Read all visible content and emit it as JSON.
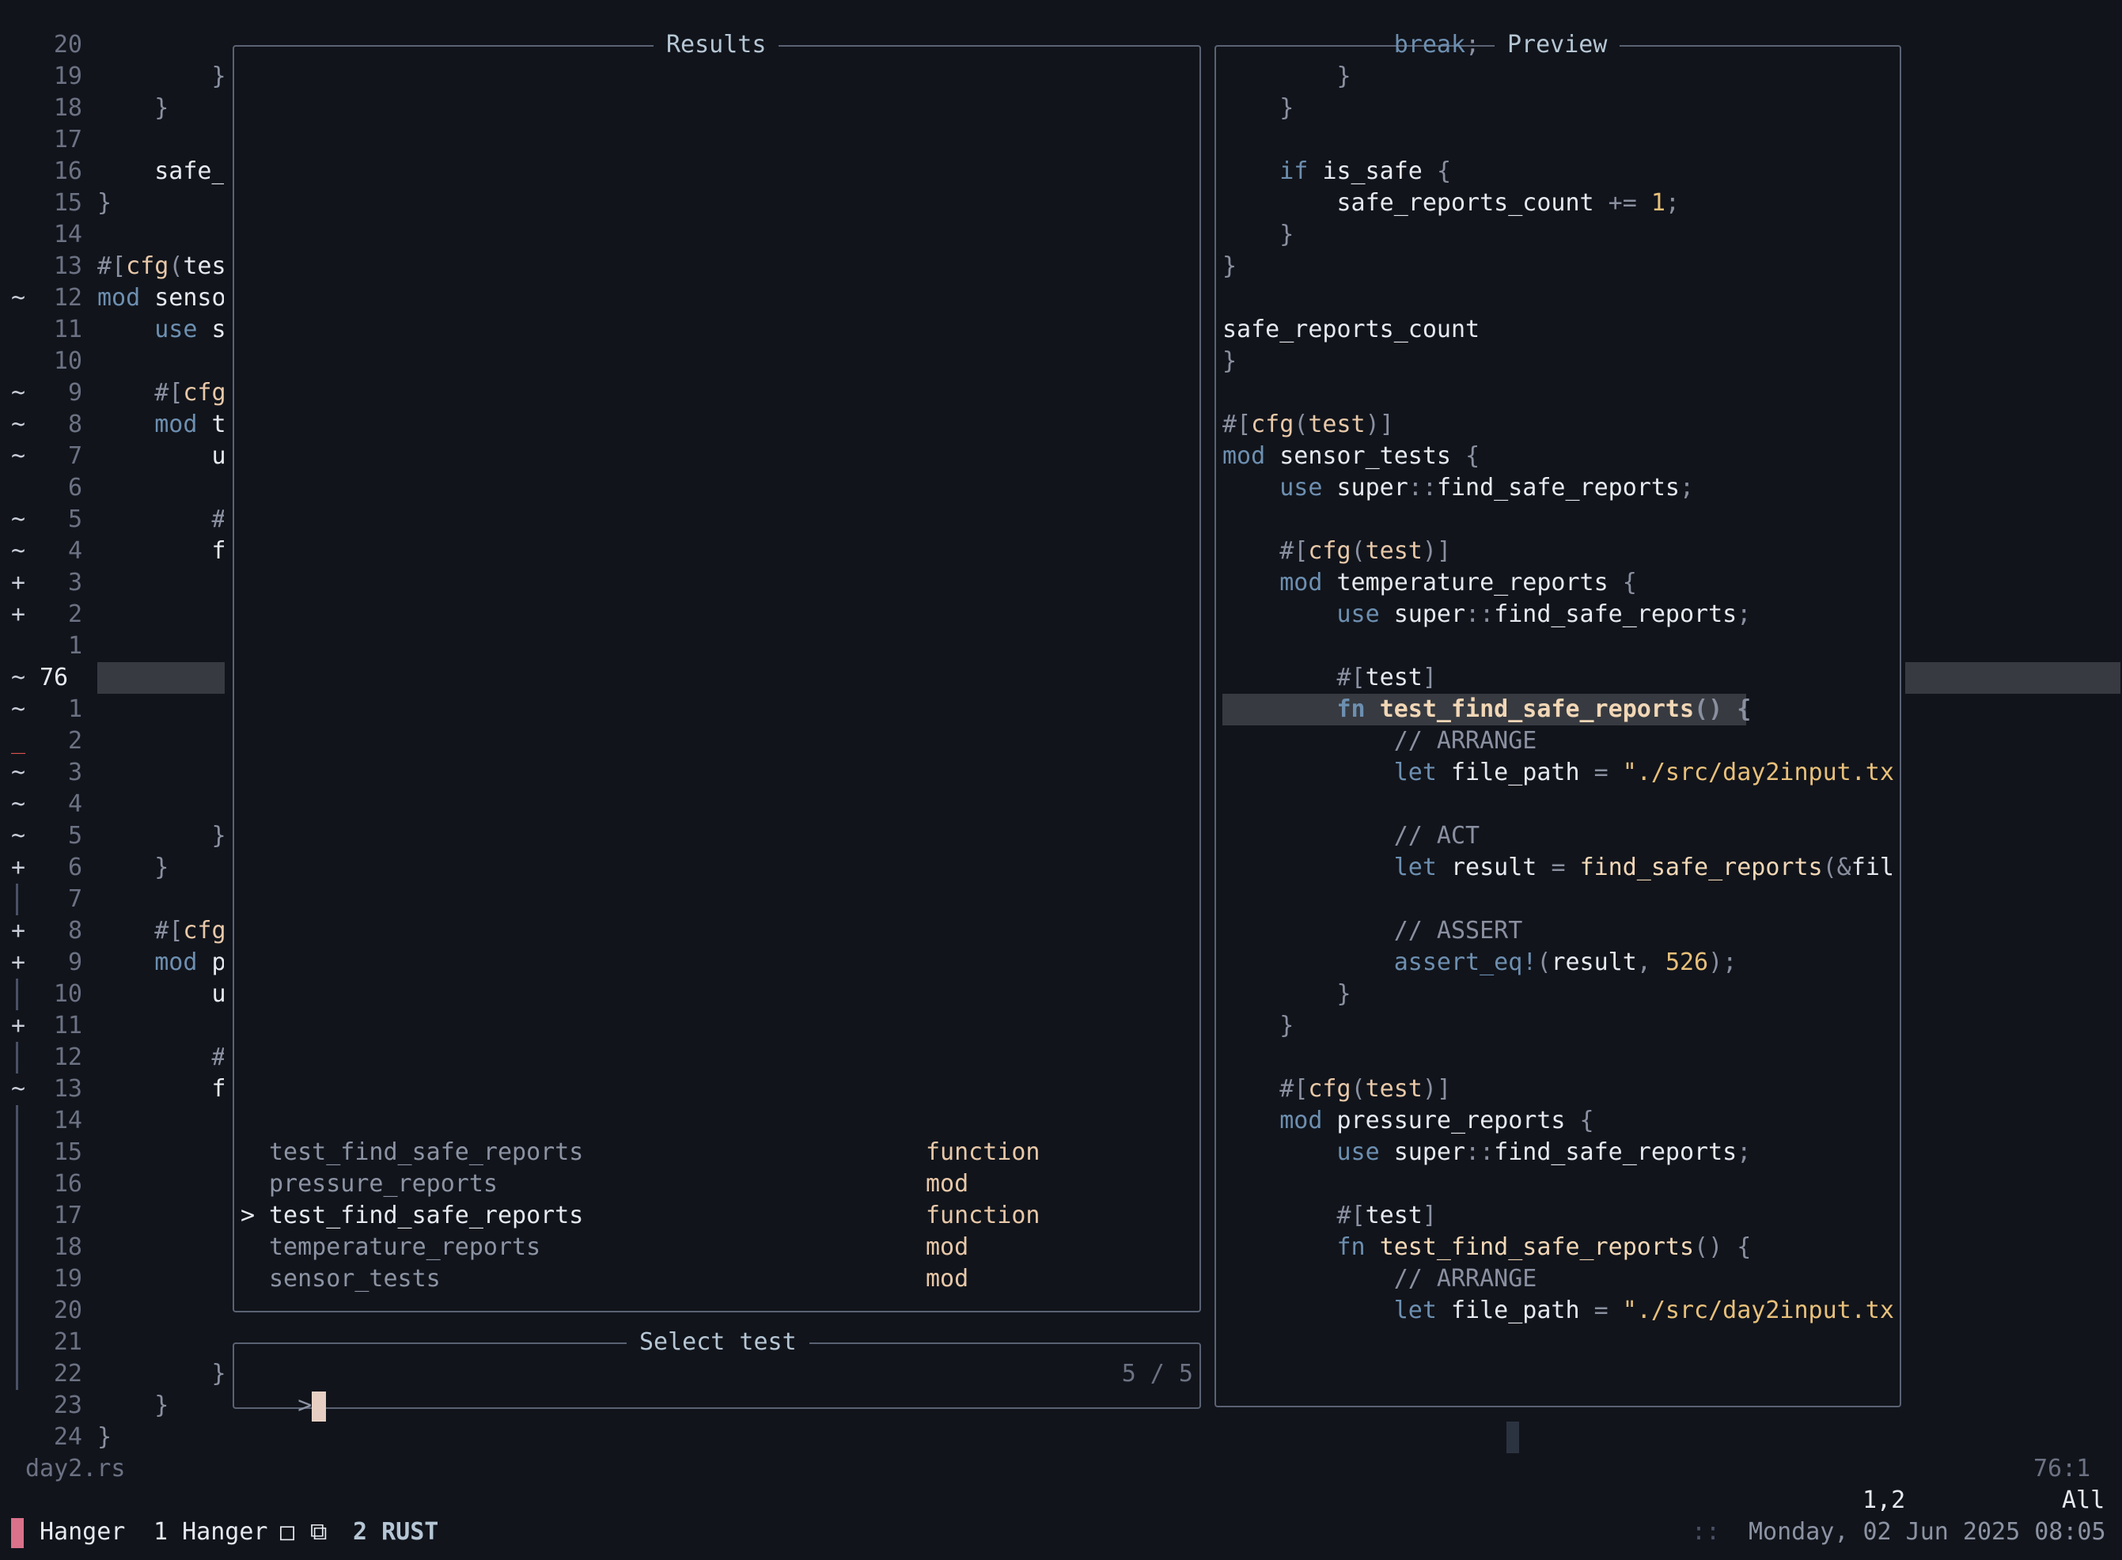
{
  "editor": {
    "filename": "day2.rs",
    "position": "76:1",
    "lines": [
      {
        "sign": "",
        "num": "20",
        "code": ""
      },
      {
        "sign": "",
        "num": "19",
        "code": "        }"
      },
      {
        "sign": "",
        "num": "18",
        "code": "    }"
      },
      {
        "sign": "",
        "num": "17",
        "code": ""
      },
      {
        "sign": "",
        "num": "16",
        "code": "    safe_"
      },
      {
        "sign": "",
        "num": "15",
        "code": "}"
      },
      {
        "sign": "",
        "num": "14",
        "code": ""
      },
      {
        "sign": "",
        "num": "13",
        "code": "#[cfg(tes"
      },
      {
        "sign": "~",
        "num": "12",
        "code": "mod senso"
      },
      {
        "sign": "",
        "num": "11",
        "code": "    use s"
      },
      {
        "sign": "",
        "num": "10",
        "code": ""
      },
      {
        "sign": "~",
        "num": "9",
        "code": "    #[cfg"
      },
      {
        "sign": "~",
        "num": "8",
        "code": "    mod t"
      },
      {
        "sign": "~",
        "num": "7",
        "code": "        u"
      },
      {
        "sign": "",
        "num": "6",
        "code": ""
      },
      {
        "sign": "~",
        "num": "5",
        "code": "        #"
      },
      {
        "sign": "~",
        "num": "4",
        "code": "        f"
      },
      {
        "sign": "+",
        "num": "3",
        "code": ""
      },
      {
        "sign": "+",
        "num": "2",
        "code": ""
      },
      {
        "sign": "",
        "num": "1",
        "code": ""
      },
      {
        "sign": "~",
        "num": "76",
        "code": "",
        "current": true
      },
      {
        "sign": "~",
        "num": "1",
        "code": ""
      },
      {
        "sign": "_",
        "num": "2",
        "code": ""
      },
      {
        "sign": "~",
        "num": "3",
        "code": ""
      },
      {
        "sign": "~",
        "num": "4",
        "code": ""
      },
      {
        "sign": "~",
        "num": "5",
        "code": "        }"
      },
      {
        "sign": "+",
        "num": "6",
        "code": "    }"
      },
      {
        "sign": "|",
        "num": "7",
        "code": ""
      },
      {
        "sign": "+",
        "num": "8",
        "code": "    #[cfg"
      },
      {
        "sign": "+",
        "num": "9",
        "code": "    mod p"
      },
      {
        "sign": "|",
        "num": "10",
        "code": "        u"
      },
      {
        "sign": "+",
        "num": "11",
        "code": ""
      },
      {
        "sign": "|",
        "num": "12",
        "code": "        #"
      },
      {
        "sign": "~",
        "num": "13",
        "code": "        f"
      },
      {
        "sign": "|",
        "num": "14",
        "code": ""
      },
      {
        "sign": "|",
        "num": "15",
        "code": ""
      },
      {
        "sign": "|",
        "num": "16",
        "code": ""
      },
      {
        "sign": "|",
        "num": "17",
        "code": ""
      },
      {
        "sign": "|",
        "num": "18",
        "code": ""
      },
      {
        "sign": "|",
        "num": "19",
        "code": ""
      },
      {
        "sign": "|",
        "num": "20",
        "code": ""
      },
      {
        "sign": "|",
        "num": "21",
        "code": ""
      },
      {
        "sign": "|",
        "num": "22",
        "code": "        }"
      },
      {
        "sign": "",
        "num": "23",
        "code": "    }"
      },
      {
        "sign": "",
        "num": "24",
        "code": "}"
      }
    ]
  },
  "results": {
    "title": "Results",
    "items": [
      {
        "name": "test_find_safe_reports",
        "kind": "function",
        "selected": false
      },
      {
        "name": "pressure_reports",
        "kind": "mod",
        "selected": false
      },
      {
        "name": "test_find_safe_reports",
        "kind": "function",
        "selected": true
      },
      {
        "name": "temperature_reports",
        "kind": "mod",
        "selected": false
      },
      {
        "name": "sensor_tests",
        "kind": "mod",
        "selected": false
      }
    ],
    "selection_marker": ">"
  },
  "prompt": {
    "title": "Select test",
    "prefix": ">",
    "value": "",
    "count": "5 / 5"
  },
  "preview": {
    "title": "Preview",
    "lines": [
      "            break;",
      "        }",
      "    }",
      "",
      "    if is_safe {",
      "        safe_reports_count += 1;",
      "    }",
      "}",
      "",
      "safe_reports_count",
      "}",
      "",
      "#[cfg(test)]",
      "mod sensor_tests {",
      "    use super::find_safe_reports;",
      "",
      "    #[cfg(test)]",
      "    mod temperature_reports {",
      "        use super::find_safe_reports;",
      "",
      "        #[test]",
      "        fn test_find_safe_reports() {",
      "            // ARRANGE",
      "            let file_path = \"./src/day2input.tx",
      "",
      "            // ACT",
      "            let result = find_safe_reports(&fil",
      "",
      "            // ASSERT",
      "            assert_eq!(result, 526);",
      "        }",
      "    }",
      "",
      "    #[cfg(test)]",
      "    mod pressure_reports {",
      "        use super::find_safe_reports;",
      "",
      "        #[test]",
      "        fn test_find_safe_reports() {",
      "            // ARRANGE",
      "            let file_path = \"./src/day2input.tx"
    ],
    "highlight_line": 21
  },
  "ruler": {
    "cursor_pos": "1,2",
    "scroll": "All"
  },
  "tmux": {
    "session": "Hanger",
    "window1": "1 Hanger",
    "window2": "2 RUST",
    "separator": "::",
    "datetime": "Monday, 02 Jun 2025 08:05"
  },
  "colors": {
    "background": "#11141b",
    "session_marker": "#d9728a",
    "string": "#e8c07a",
    "keyword": "#6d8fb0"
  }
}
